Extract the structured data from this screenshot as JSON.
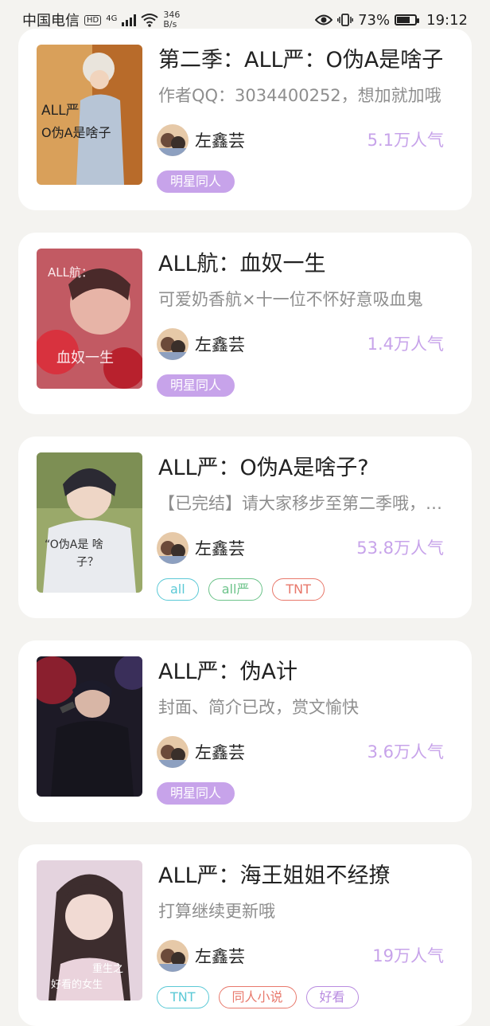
{
  "status_bar": {
    "carrier": "中国电信",
    "network_badge": "HD",
    "network_type": "4G",
    "speed_value": "346",
    "speed_unit": "B/s",
    "battery": "73%",
    "battery_level": 0.73,
    "time": "19:12",
    "icons": [
      "signal-icon",
      "wifi-icon",
      "eye-icon",
      "vibrate-icon",
      "battery-icon"
    ]
  },
  "colors": {
    "popularity": "#c7a3ea",
    "tag_filled": "#c7a3ea",
    "tag_cyan": "#5bc9d6",
    "tag_green": "#6cc38a",
    "tag_red": "#e8786b",
    "tag_purple": "#b88be0"
  },
  "books": [
    {
      "title": "第二季：ALL严：O伪A是啥子",
      "description": "作者QQ：3034400252，想加就加哦",
      "author": "左鑫芸",
      "popularity": "5.1万人气",
      "cover_text": [
        "ALL严",
        "O伪A是啥子"
      ],
      "tags": [
        {
          "label": "明星同人",
          "style": "filled"
        }
      ]
    },
    {
      "title": "ALL航：血奴一生",
      "description": "可爱奶香航×十一位不怀好意吸血鬼",
      "author": "左鑫芸",
      "popularity": "1.4万人气",
      "cover_text": [
        "ALL航：",
        "血奴一生"
      ],
      "tags": [
        {
          "label": "明星同人",
          "style": "filled"
        }
      ]
    },
    {
      "title": "ALL严：O伪A是啥子?",
      "description": "【已完结】请大家移步至第二季哦，谢谢",
      "author": "左鑫芸",
      "popularity": "53.8万人气",
      "cover_text": [
        "“O伪A是 啥",
        "子？"
      ],
      "tags": [
        {
          "label": "all",
          "style": "cyan"
        },
        {
          "label": "all严",
          "style": "green"
        },
        {
          "label": "TNT",
          "style": "red"
        }
      ]
    },
    {
      "title": "ALL严：伪A计",
      "description": "封面、简介已改，赏文愉快",
      "author": "左鑫芸",
      "popularity": "3.6万人气",
      "cover_text": [],
      "tags": [
        {
          "label": "明星同人",
          "style": "filled"
        }
      ]
    },
    {
      "title": "ALL严：海王姐姐不经撩",
      "description": "打算继续更新哦",
      "author": "左鑫芸",
      "popularity": "19万人气",
      "cover_text": [
        "重生之",
        "好看的女生"
      ],
      "tags": [
        {
          "label": "TNT",
          "style": "cyan"
        },
        {
          "label": "同人小说",
          "style": "red"
        },
        {
          "label": "好看",
          "style": "purple"
        }
      ]
    }
  ]
}
